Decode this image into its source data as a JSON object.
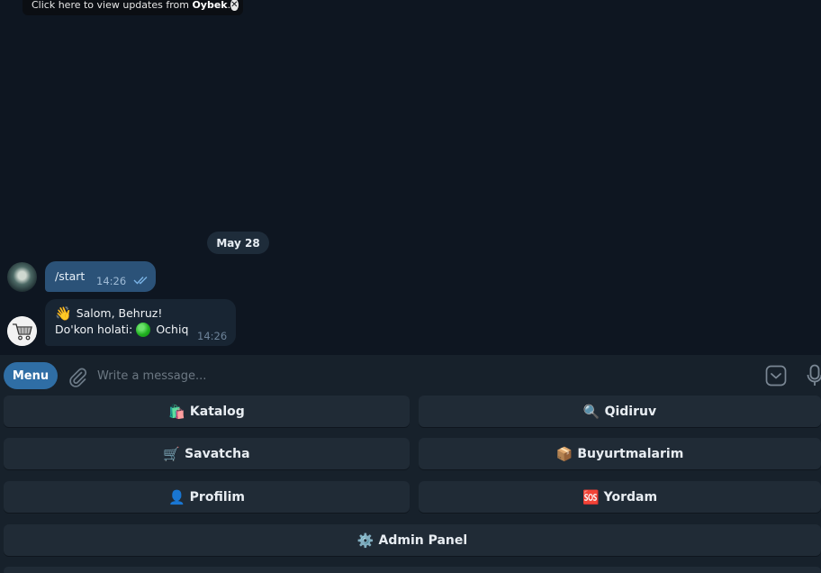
{
  "toast": {
    "text_prefix": "Click here to view updates from",
    "sender": "Oybek",
    "text_suffix": ".",
    "close_glyph": "✕"
  },
  "chat": {
    "date_label": "May 28",
    "messages": [
      {
        "direction": "outgoing",
        "text": "/start",
        "time": "14:26",
        "status": "read-double-check"
      },
      {
        "direction": "incoming",
        "line1_emoji": "👋",
        "line1_text": "Salom, Behruz!",
        "line2_text_before": "Do'kon holati:",
        "line2_status_icon": "green-circle",
        "line2_text_after": "Ochiq",
        "time": "14:26"
      }
    ]
  },
  "composer": {
    "menu_label": "Menu",
    "placeholder": "Write a message...",
    "icons": [
      "paperclip-icon",
      "keyboard-toggle-icon",
      "microphone-icon"
    ]
  },
  "keyboard": {
    "buttons": [
      {
        "emoji": "🛍️",
        "label": "Katalog"
      },
      {
        "emoji": "🔍",
        "label": "Qidiruv"
      },
      {
        "emoji": "🛒",
        "label": "Savatcha"
      },
      {
        "emoji": "📦",
        "label": "Buyurtmalarim"
      },
      {
        "emoji": "👤",
        "label": "Profilim"
      },
      {
        "emoji": "🆘",
        "label": "Yordam"
      },
      {
        "emoji": "⚙️",
        "label": "Admin Panel"
      }
    ]
  },
  "colors": {
    "chat_background": "#0e1621",
    "panel_background": "#17212b",
    "outgoing_bubble": "#2b5278",
    "incoming_bubble": "#182533",
    "menu_button": "#2f6ea5",
    "keyboard_button": "#202b36"
  }
}
